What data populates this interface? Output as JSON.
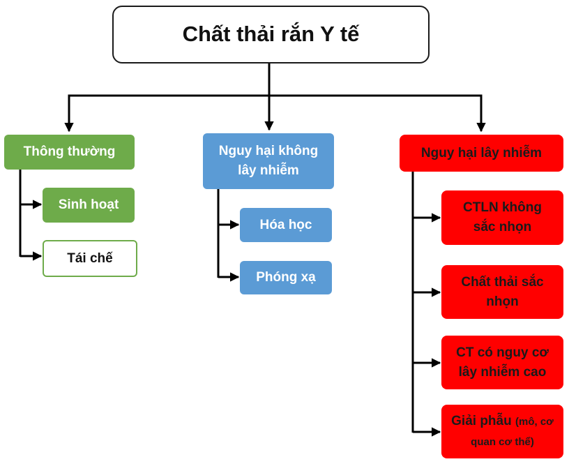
{
  "diagram": {
    "root": {
      "label": "Chất thải rắn Y tế"
    },
    "categories": [
      {
        "label": "Thông thường",
        "children": [
          {
            "label": "Sinh hoạt"
          },
          {
            "label": "Tái chế"
          }
        ]
      },
      {
        "label": "Nguy hại không lây nhiễm",
        "children": [
          {
            "label": "Hóa học"
          },
          {
            "label": "Phóng xạ"
          }
        ]
      },
      {
        "label": "Nguy hại lây nhiễm",
        "children": [
          {
            "label": "CTLN không sắc nhọn"
          },
          {
            "label": "Chất thải sắc nhọn"
          },
          {
            "label": "CT có nguy cơ lây nhiễm cao"
          },
          {
            "label": "Giải phẫu",
            "note": "(mô, cơ quan cơ thể)"
          }
        ]
      }
    ]
  },
  "colors": {
    "green": "#6eab4a",
    "blue": "#5b9bd5",
    "red": "#ff0000",
    "line": "#000000"
  }
}
